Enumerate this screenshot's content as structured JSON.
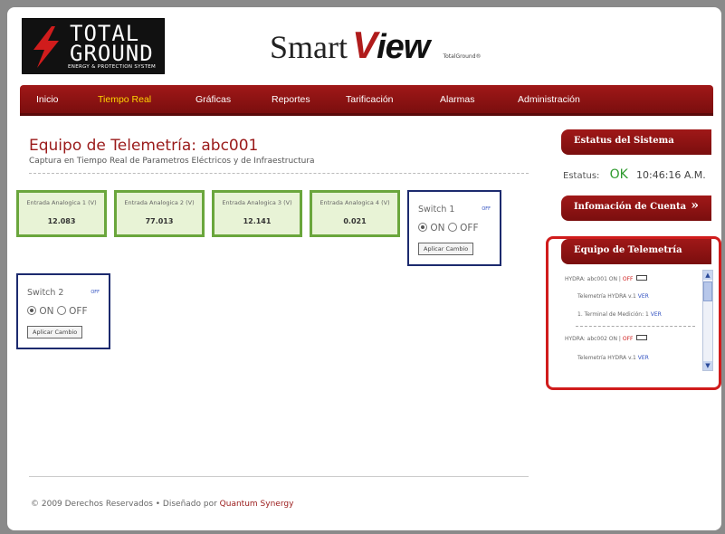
{
  "header": {
    "logo_line1": "TOTAL",
    "logo_line2": "GROUND",
    "logo_tagline": "ENERGY & PROTECTION SYSTEM",
    "brand_smart": "Smart",
    "brand_v": "V",
    "brand_iew": "iew",
    "brand_small": "TotalGround®"
  },
  "nav": {
    "items": [
      {
        "label": "Inicio",
        "active": false
      },
      {
        "label": "Tiempo Real",
        "active": true
      },
      {
        "label": "Gráficas",
        "active": false
      },
      {
        "label": "Reportes",
        "active": false
      },
      {
        "label": "Tarificación",
        "active": false
      },
      {
        "label": "Alarmas",
        "active": false
      },
      {
        "label": "Administración",
        "active": false
      }
    ]
  },
  "main": {
    "title": "Equipo de Telemetría: abc001",
    "subtitle": "Captura en Tiempo Real de Parametros Eléctricos y de Infraestructura",
    "analog_inputs": [
      {
        "label": "Entrada Analogica 1 (V)",
        "value": "12.083"
      },
      {
        "label": "Entrada Analogica 2 (V)",
        "value": "77.013"
      },
      {
        "label": "Entrada Analogica 3 (V)",
        "value": "12.141"
      },
      {
        "label": "Entrada Analogica 4 (V)",
        "value": "0.021"
      }
    ],
    "switches": [
      {
        "name": "Switch 1",
        "off_link": "OFF",
        "on_label": "ON",
        "off_label": "OFF",
        "selected": "ON",
        "apply_label": "Aplicar Cambio"
      },
      {
        "name": "Switch 2",
        "off_link": "OFF",
        "on_label": "ON",
        "off_label": "OFF",
        "selected": "ON",
        "apply_label": "Aplicar Cambio"
      }
    ]
  },
  "footer": {
    "copyright": "© 2009 Derechos Reservados • Diseñado por ",
    "designer": "Quantum Synergy"
  },
  "sidebar": {
    "status_header": "Estatus del Sistema",
    "status_label": "Estatus:",
    "status_value": "OK",
    "status_time": "10:46:16 A.M.",
    "account_header": "Infomación de Cuenta",
    "telemetry_header": "Equipo de Telemetría",
    "telemetry_items": [
      {
        "device": "HYDRA: abc001 ON | ",
        "off": "OFF"
      },
      {
        "version_text": "Telemetría HYDRA v.1 ",
        "ver": "VER"
      },
      {
        "terminal_text": "1. Terminal de Medición: 1 ",
        "ver": "VER"
      },
      {
        "device": "HYDRA: abc002 ON | ",
        "off": "OFF"
      },
      {
        "version_text": "Telemetría HYDRA v.1 ",
        "ver": "VER"
      }
    ]
  },
  "colors": {
    "nav_red": "#8e1414",
    "active_nav": "#ffd700",
    "title_red": "#9a1a1a",
    "analog_border": "#6aa63c",
    "switch_border": "#1c2a6e",
    "ok_green": "#2e9a2e",
    "highlight_red": "#d01c1c"
  }
}
